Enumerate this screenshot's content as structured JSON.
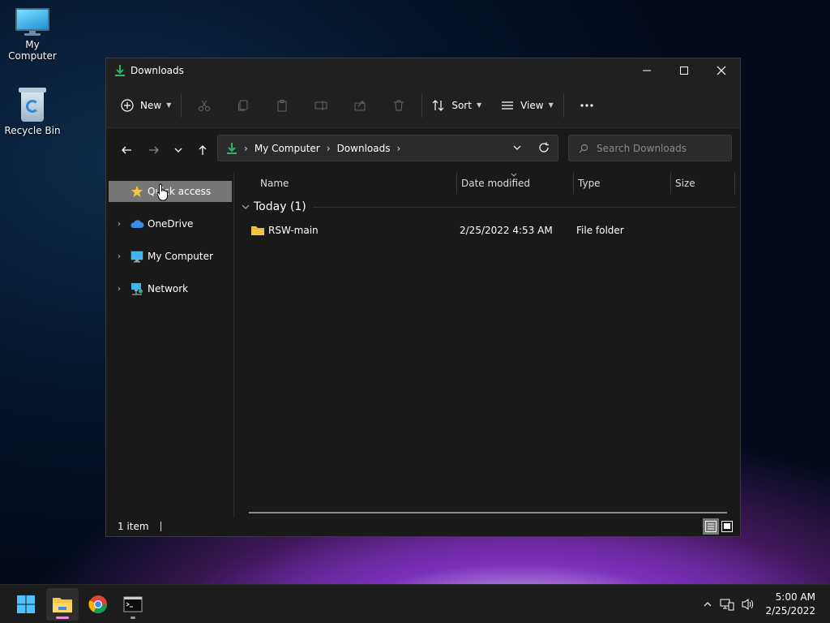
{
  "desktop": {
    "icons": [
      {
        "label": "My Computer",
        "icon": "monitor-icon"
      },
      {
        "label": "Recycle Bin",
        "icon": "recycle-bin-icon"
      }
    ]
  },
  "window": {
    "title": "Downloads",
    "title_icon": "download-icon",
    "controls": {
      "minimize": "minimize-icon",
      "maximize": "maximize-icon",
      "close": "close-icon"
    }
  },
  "toolbar": {
    "new_label": "New",
    "sort_label": "Sort",
    "view_label": "View",
    "disabled_actions": [
      "cut-icon",
      "copy-icon",
      "paste-icon",
      "rename-icon",
      "share-icon",
      "delete-icon"
    ],
    "more": "more-options-icon"
  },
  "address": {
    "segments": [
      "My Computer",
      "Downloads"
    ],
    "search_placeholder": "Search Downloads"
  },
  "nav_pane": {
    "items": [
      {
        "label": "Quick access",
        "icon": "star-icon",
        "selected": true
      },
      {
        "label": "OneDrive",
        "icon": "cloud-icon"
      },
      {
        "label": "My Computer",
        "icon": "monitor-icon"
      },
      {
        "label": "Network",
        "icon": "network-icon"
      }
    ]
  },
  "content": {
    "columns": [
      "Name",
      "Date modified",
      "Type",
      "Size"
    ],
    "group": "Today (1)",
    "rows": [
      {
        "name": "RSW-main",
        "date": "2/25/2022 4:53 AM",
        "type": "File folder",
        "size": ""
      }
    ]
  },
  "status": {
    "count": "1 item"
  },
  "taskbar": {
    "apps": [
      "start-icon",
      "file-explorer-icon",
      "chrome-icon",
      "terminal-icon"
    ],
    "clock_time": "5:00 AM",
    "clock_date": "2/25/2022"
  },
  "colors": {
    "accent_green": "#2fb36b",
    "folder_yellow": "#f4c542",
    "selection": "#777777"
  }
}
